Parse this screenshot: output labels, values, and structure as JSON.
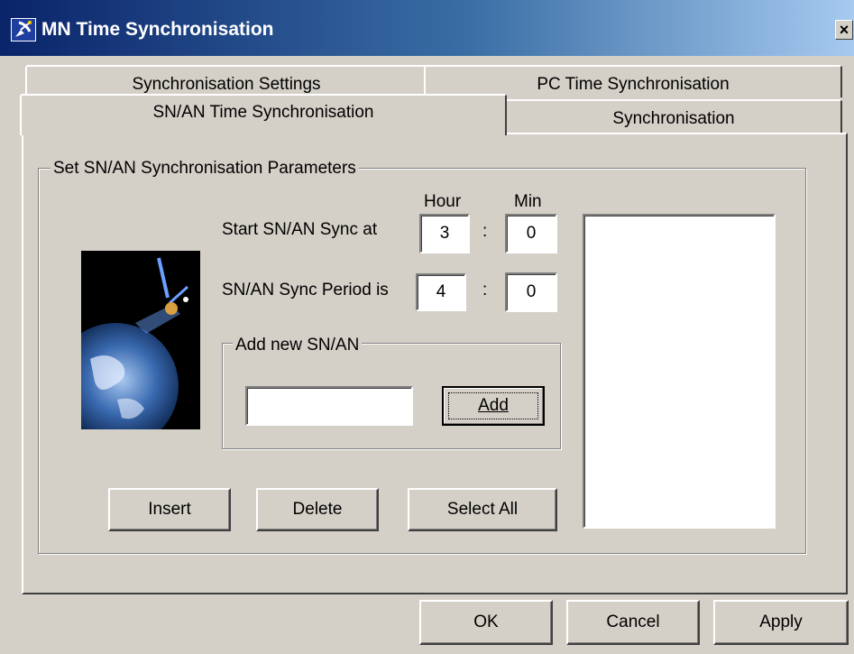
{
  "window": {
    "title": "MN Time Synchronisation",
    "close_glyph": "×"
  },
  "tabs": {
    "synchronisation_settings": "Synchronisation Settings",
    "pc_time_synchronisation": "PC Time Synchronisation",
    "sn_an_time_synchronisation": "SN/AN Time Synchronisation",
    "synchronisation": "Synchronisation"
  },
  "params_group": {
    "title": "Set SN/AN Synchronisation Parameters",
    "hour_label": "Hour",
    "min_label": "Min",
    "start_label": "Start SN/AN Sync at",
    "start_hour": "3",
    "start_min": "0",
    "period_label": "SN/AN Sync Period is",
    "period_hour": "4",
    "period_min": "0",
    "colon": ":"
  },
  "add_group": {
    "title": "Add new SN/AN",
    "input_value": "",
    "add_label": "Add"
  },
  "actions": {
    "insert": "Insert",
    "delete": "Delete",
    "select_all": "Select All"
  },
  "dialog_buttons": {
    "ok": "OK",
    "cancel": "Cancel",
    "apply": "Apply"
  },
  "icons": {
    "app_icon": "satellite-dish-icon",
    "close": "close-icon",
    "illustration": "satellite-earth-image"
  },
  "colors": {
    "titlebar_start": "#0a246a",
    "titlebar_end": "#a6caf0",
    "face": "#d4d0c8"
  }
}
